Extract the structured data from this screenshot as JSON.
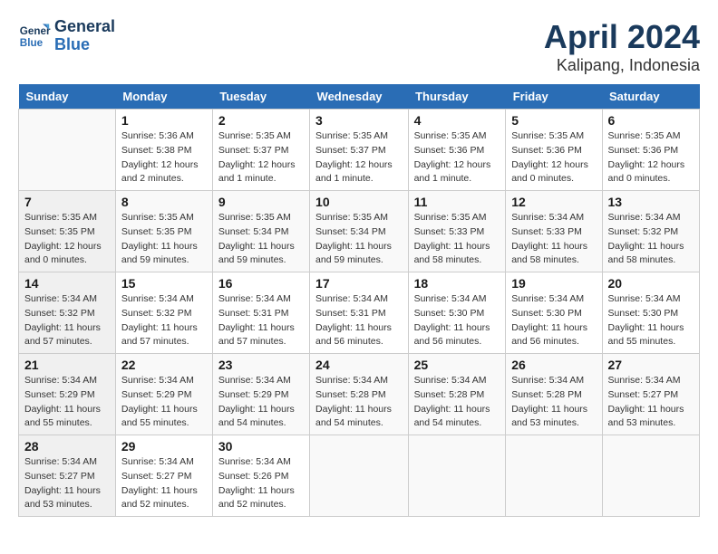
{
  "header": {
    "logo_line1": "General",
    "logo_line2": "Blue",
    "month": "April 2024",
    "location": "Kalipang, Indonesia"
  },
  "weekdays": [
    "Sunday",
    "Monday",
    "Tuesday",
    "Wednesday",
    "Thursday",
    "Friday",
    "Saturday"
  ],
  "weeks": [
    [
      {
        "day": "",
        "sunrise": "",
        "sunset": "",
        "daylight": ""
      },
      {
        "day": "1",
        "sunrise": "Sunrise: 5:36 AM",
        "sunset": "Sunset: 5:38 PM",
        "daylight": "Daylight: 12 hours and 2 minutes."
      },
      {
        "day": "2",
        "sunrise": "Sunrise: 5:35 AM",
        "sunset": "Sunset: 5:37 PM",
        "daylight": "Daylight: 12 hours and 1 minute."
      },
      {
        "day": "3",
        "sunrise": "Sunrise: 5:35 AM",
        "sunset": "Sunset: 5:37 PM",
        "daylight": "Daylight: 12 hours and 1 minute."
      },
      {
        "day": "4",
        "sunrise": "Sunrise: 5:35 AM",
        "sunset": "Sunset: 5:36 PM",
        "daylight": "Daylight: 12 hours and 1 minute."
      },
      {
        "day": "5",
        "sunrise": "Sunrise: 5:35 AM",
        "sunset": "Sunset: 5:36 PM",
        "daylight": "Daylight: 12 hours and 0 minutes."
      },
      {
        "day": "6",
        "sunrise": "Sunrise: 5:35 AM",
        "sunset": "Sunset: 5:36 PM",
        "daylight": "Daylight: 12 hours and 0 minutes."
      }
    ],
    [
      {
        "day": "7",
        "sunrise": "Sunrise: 5:35 AM",
        "sunset": "Sunset: 5:35 PM",
        "daylight": "Daylight: 12 hours and 0 minutes."
      },
      {
        "day": "8",
        "sunrise": "Sunrise: 5:35 AM",
        "sunset": "Sunset: 5:35 PM",
        "daylight": "Daylight: 11 hours and 59 minutes."
      },
      {
        "day": "9",
        "sunrise": "Sunrise: 5:35 AM",
        "sunset": "Sunset: 5:34 PM",
        "daylight": "Daylight: 11 hours and 59 minutes."
      },
      {
        "day": "10",
        "sunrise": "Sunrise: 5:35 AM",
        "sunset": "Sunset: 5:34 PM",
        "daylight": "Daylight: 11 hours and 59 minutes."
      },
      {
        "day": "11",
        "sunrise": "Sunrise: 5:35 AM",
        "sunset": "Sunset: 5:33 PM",
        "daylight": "Daylight: 11 hours and 58 minutes."
      },
      {
        "day": "12",
        "sunrise": "Sunrise: 5:34 AM",
        "sunset": "Sunset: 5:33 PM",
        "daylight": "Daylight: 11 hours and 58 minutes."
      },
      {
        "day": "13",
        "sunrise": "Sunrise: 5:34 AM",
        "sunset": "Sunset: 5:32 PM",
        "daylight": "Daylight: 11 hours and 58 minutes."
      }
    ],
    [
      {
        "day": "14",
        "sunrise": "Sunrise: 5:34 AM",
        "sunset": "Sunset: 5:32 PM",
        "daylight": "Daylight: 11 hours and 57 minutes."
      },
      {
        "day": "15",
        "sunrise": "Sunrise: 5:34 AM",
        "sunset": "Sunset: 5:32 PM",
        "daylight": "Daylight: 11 hours and 57 minutes."
      },
      {
        "day": "16",
        "sunrise": "Sunrise: 5:34 AM",
        "sunset": "Sunset: 5:31 PM",
        "daylight": "Daylight: 11 hours and 57 minutes."
      },
      {
        "day": "17",
        "sunrise": "Sunrise: 5:34 AM",
        "sunset": "Sunset: 5:31 PM",
        "daylight": "Daylight: 11 hours and 56 minutes."
      },
      {
        "day": "18",
        "sunrise": "Sunrise: 5:34 AM",
        "sunset": "Sunset: 5:30 PM",
        "daylight": "Daylight: 11 hours and 56 minutes."
      },
      {
        "day": "19",
        "sunrise": "Sunrise: 5:34 AM",
        "sunset": "Sunset: 5:30 PM",
        "daylight": "Daylight: 11 hours and 56 minutes."
      },
      {
        "day": "20",
        "sunrise": "Sunrise: 5:34 AM",
        "sunset": "Sunset: 5:30 PM",
        "daylight": "Daylight: 11 hours and 55 minutes."
      }
    ],
    [
      {
        "day": "21",
        "sunrise": "Sunrise: 5:34 AM",
        "sunset": "Sunset: 5:29 PM",
        "daylight": "Daylight: 11 hours and 55 minutes."
      },
      {
        "day": "22",
        "sunrise": "Sunrise: 5:34 AM",
        "sunset": "Sunset: 5:29 PM",
        "daylight": "Daylight: 11 hours and 55 minutes."
      },
      {
        "day": "23",
        "sunrise": "Sunrise: 5:34 AM",
        "sunset": "Sunset: 5:29 PM",
        "daylight": "Daylight: 11 hours and 54 minutes."
      },
      {
        "day": "24",
        "sunrise": "Sunrise: 5:34 AM",
        "sunset": "Sunset: 5:28 PM",
        "daylight": "Daylight: 11 hours and 54 minutes."
      },
      {
        "day": "25",
        "sunrise": "Sunrise: 5:34 AM",
        "sunset": "Sunset: 5:28 PM",
        "daylight": "Daylight: 11 hours and 54 minutes."
      },
      {
        "day": "26",
        "sunrise": "Sunrise: 5:34 AM",
        "sunset": "Sunset: 5:28 PM",
        "daylight": "Daylight: 11 hours and 53 minutes."
      },
      {
        "day": "27",
        "sunrise": "Sunrise: 5:34 AM",
        "sunset": "Sunset: 5:27 PM",
        "daylight": "Daylight: 11 hours and 53 minutes."
      }
    ],
    [
      {
        "day": "28",
        "sunrise": "Sunrise: 5:34 AM",
        "sunset": "Sunset: 5:27 PM",
        "daylight": "Daylight: 11 hours and 53 minutes."
      },
      {
        "day": "29",
        "sunrise": "Sunrise: 5:34 AM",
        "sunset": "Sunset: 5:27 PM",
        "daylight": "Daylight: 11 hours and 52 minutes."
      },
      {
        "day": "30",
        "sunrise": "Sunrise: 5:34 AM",
        "sunset": "Sunset: 5:26 PM",
        "daylight": "Daylight: 11 hours and 52 minutes."
      },
      {
        "day": "",
        "sunrise": "",
        "sunset": "",
        "daylight": ""
      },
      {
        "day": "",
        "sunrise": "",
        "sunset": "",
        "daylight": ""
      },
      {
        "day": "",
        "sunrise": "",
        "sunset": "",
        "daylight": ""
      },
      {
        "day": "",
        "sunrise": "",
        "sunset": "",
        "daylight": ""
      }
    ]
  ]
}
